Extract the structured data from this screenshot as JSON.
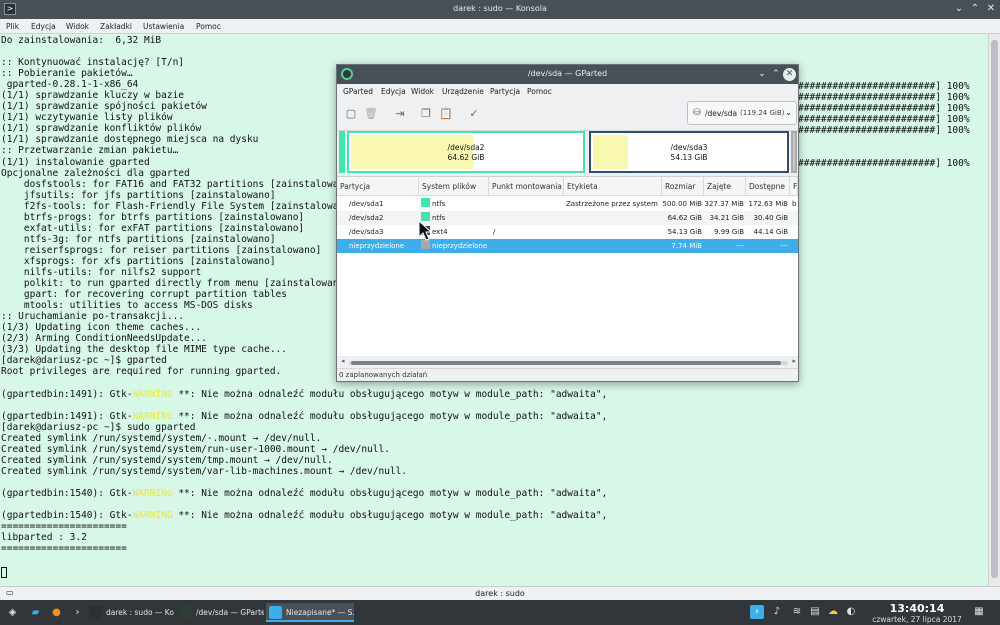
{
  "konsole": {
    "title": "darek : sudo — Konsola",
    "menu": [
      "Plik",
      "Edycja",
      "Widok",
      "Zakładki",
      "Ustawienia",
      "Pomoc"
    ],
    "tab_label": "darek : sudo",
    "lines": [
      "Do zainstalowania:  6,32 MiB",
      "",
      ":: Kontynuować instalację? [T/n]",
      ":: Pobieranie pakietów…",
      " gparted-0.28.1-1-x86_64",
      "(1/1) sprawdzanie kluczy w bazie",
      "(1/1) sprawdzanie spójności pakietów",
      "(1/1) wczytywanie listy plików",
      "(1/1) sprawdzanie konfliktów plików",
      "(1/1) sprawdzanie dostępnego miejsca na dysku",
      ":: Przetwarzanie zmian pakietu…",
      "(1/1) instalowanie gparted",
      "Opcjonalne zależności dla gparted",
      "    dosfstools: for FAT16 and FAT32 partitions [zainstalowano]",
      "    jfsutils: for jfs partitions [zainstalowano]",
      "    f2fs-tools: for Flash-Friendly File System [zainstalowano]",
      "    btrfs-progs: for btrfs partitions [zainstalowano]",
      "    exfat-utils: for exFAT partitions [zainstalowano]",
      "    ntfs-3g: for ntfs partitions [zainstalowano]",
      "    reiserfsprogs: for reiser partitions [zainstalowano]",
      "    xfsprogs: for xfs partitions [zainstalowano]",
      "    nilfs-utils: for nilfs2 support",
      "    polkit: to run gparted directly from menu [zainstalowano]",
      "    gpart: for recovering corrupt partition tables",
      "    mtools: utilities to access MS-DOS disks",
      ":: Uruchamianie po-transakcji...",
      "(1/3) Updating icon theme caches...",
      "(2/3) Arming ConditionNeedsUpdate...",
      "(3/3) Updating the desktop file MIME type cache...",
      "[darek@dariusz-pc ~]$ gparted",
      "Root privileges are required for running gparted.",
      "",
      "(gpartedbin:1491): Gtk-WARNING **: Nie można odnaleźć modułu obsługującego motyw w module_path: \"adwaita\",",
      "",
      "(gpartedbin:1491): Gtk-WARNING **: Nie można odnaleźć modułu obsługującego motyw w module_path: \"adwaita\",",
      "[darek@dariusz-pc ~]$ sudo gparted",
      "Created symlink /run/systemd/system/-.mount → /dev/null.",
      "Created symlink /run/systemd/system/run-user-1000.mount → /dev/null.",
      "Created symlink /run/systemd/system/tmp.mount → /dev/null.",
      "Created symlink /run/systemd/system/var-lib-machines.mount → /dev/null.",
      "",
      "(gpartedbin:1540): Gtk-WARNING **: Nie można odnaleźć modułu obsługującego motyw w module_path: \"adwaita\",",
      "",
      "(gpartedbin:1540): Gtk-WARNING **: Nie można odnaleźć modułu obsługującego motyw w module_path: \"adwaita\",",
      "======================",
      "libparted : 3.2",
      "======================"
    ],
    "progress_lines": [
      "########################] 100%",
      "########################] 100%",
      "########################] 100%",
      "########################] 100%",
      "########################] 100%",
      "",
      "",
      "########################] 100%"
    ]
  },
  "gparted": {
    "title": "/dev/sda — GParted",
    "menu": [
      "GParted",
      "Edycja",
      "Widok",
      "Urządzenie",
      "Partycja",
      "Pomoc"
    ],
    "toolbar_icons": [
      "new-partition-icon",
      "delete-icon",
      "resize-icon",
      "copy-icon",
      "paste-icon",
      "apply-icon"
    ],
    "device": {
      "name": "/dev/sda",
      "size": "(119.24 GiB)"
    },
    "map": [
      {
        "name": "/dev/sda2",
        "size": "64.62 GiB",
        "used_fraction": 0.53
      },
      {
        "name": "/dev/sda3",
        "size": "54.13 GiB",
        "used_fraction": 0.18
      }
    ],
    "columns": [
      "Partycja",
      "System plików",
      "Punkt montowania",
      "Etykieta",
      "Rozmiar",
      "Zajęte",
      "Dostępne",
      "F"
    ],
    "rows": [
      {
        "partition": "/dev/sda1",
        "fs": "ntfs",
        "mount": "",
        "label": "Zastrzeżone przez system",
        "size": "500.00 MiB",
        "used": "327.37 MiB",
        "free": "172.63 MiB",
        "flags": "b",
        "color": "#42e5ac"
      },
      {
        "partition": "/dev/sda2",
        "fs": "ntfs",
        "mount": "",
        "label": "",
        "size": "64.62 GiB",
        "used": "34.21 GiB",
        "free": "30.40 GiB",
        "flags": "",
        "color": "#42e5ac"
      },
      {
        "partition": "/dev/sda3",
        "fs": "ext4",
        "mount": "/",
        "label": "",
        "size": "54.13 GiB",
        "used": "9.99 GiB",
        "free": "44.14 GiB",
        "flags": "",
        "color": "#314e6c"
      },
      {
        "partition": "nieprzydzielone",
        "fs": "nieprzydzielone",
        "mount": "",
        "label": "",
        "size": "7.74 MiB",
        "used": "---",
        "free": "---",
        "flags": "",
        "color": "#a9a9a9"
      }
    ],
    "status": "0 zaplanowanych działań"
  },
  "taskbar": {
    "apps": [
      {
        "label": "darek : sudo — Ko…",
        "active": false
      },
      {
        "label": "/dev/sda — GParted",
        "active": false
      },
      {
        "label": "Niezapisane* — S…",
        "active": true
      }
    ],
    "time": "13:40:14",
    "date": "czwartek, 27 lipca 2017"
  },
  "colors": {
    "terminal_bg": "#d7f7e7",
    "ntfs": "#42e5ac",
    "ext4": "#314e6c",
    "used": "#f8f8b0",
    "selection": "#3daee9",
    "warning": "#e8e84a"
  }
}
